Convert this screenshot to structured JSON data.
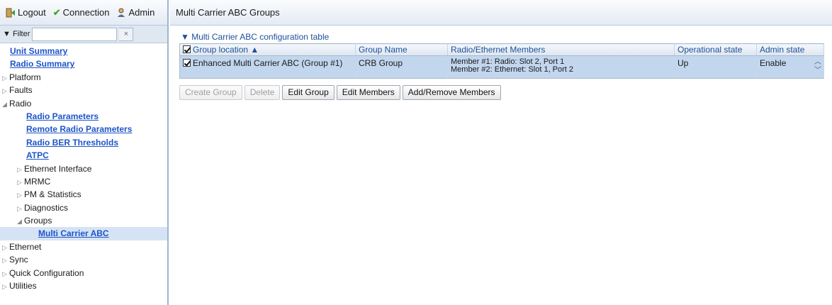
{
  "topbar": {
    "logout": "Logout",
    "connection": "Connection",
    "admin": "Admin"
  },
  "filter": {
    "label": "Filter",
    "value": "",
    "clear": "×"
  },
  "tree": {
    "unit_summary": "Unit Summary",
    "radio_summary": "Radio Summary",
    "platform": "Platform",
    "faults": "Faults",
    "radio": "Radio",
    "radio_parameters": "Radio Parameters",
    "remote_radio_parameters": "Remote Radio Parameters",
    "radio_ber_thresholds": "Radio BER Thresholds",
    "atpc": "ATPC",
    "ethernet_interface": "Ethernet Interface",
    "mrmc": "MRMC",
    "pm_statistics": "PM & Statistics",
    "diagnostics": "Diagnostics",
    "groups": "Groups",
    "multi_carrier_abc": "Multi Carrier ABC",
    "ethernet": "Ethernet",
    "sync": "Sync",
    "quick_configuration": "Quick Configuration",
    "utilities": "Utilities"
  },
  "page": {
    "title": "Multi Carrier ABC Groups",
    "section_title": "▼ Multi Carrier ABC configuration table"
  },
  "table": {
    "headers": {
      "group_location": "Group location ▲",
      "group_name": "Group Name",
      "members": "Radio/Ethernet Members",
      "operational_state": "Operational state",
      "admin_state": "Admin state"
    },
    "rows": [
      {
        "group_location": "Enhanced Multi Carrier ABC (Group #1)",
        "group_name": "CRB Group",
        "member_1": "Member #1: Radio: Slot 2, Port 1",
        "member_2": "Member #2: Ethernet: Slot 1, Port 2",
        "operational_state": "Up",
        "admin_state": "Enable"
      }
    ]
  },
  "buttons": {
    "create_group": "Create Group",
    "delete": "Delete",
    "edit_group": "Edit Group",
    "edit_members": "Edit Members",
    "add_remove_members": "Add/Remove Members"
  },
  "colors": {
    "link": "#1d55c8",
    "header_text": "#1e4f9a",
    "selected_row": "#c2d6ee",
    "selected_tree": "#d5e3f5"
  }
}
